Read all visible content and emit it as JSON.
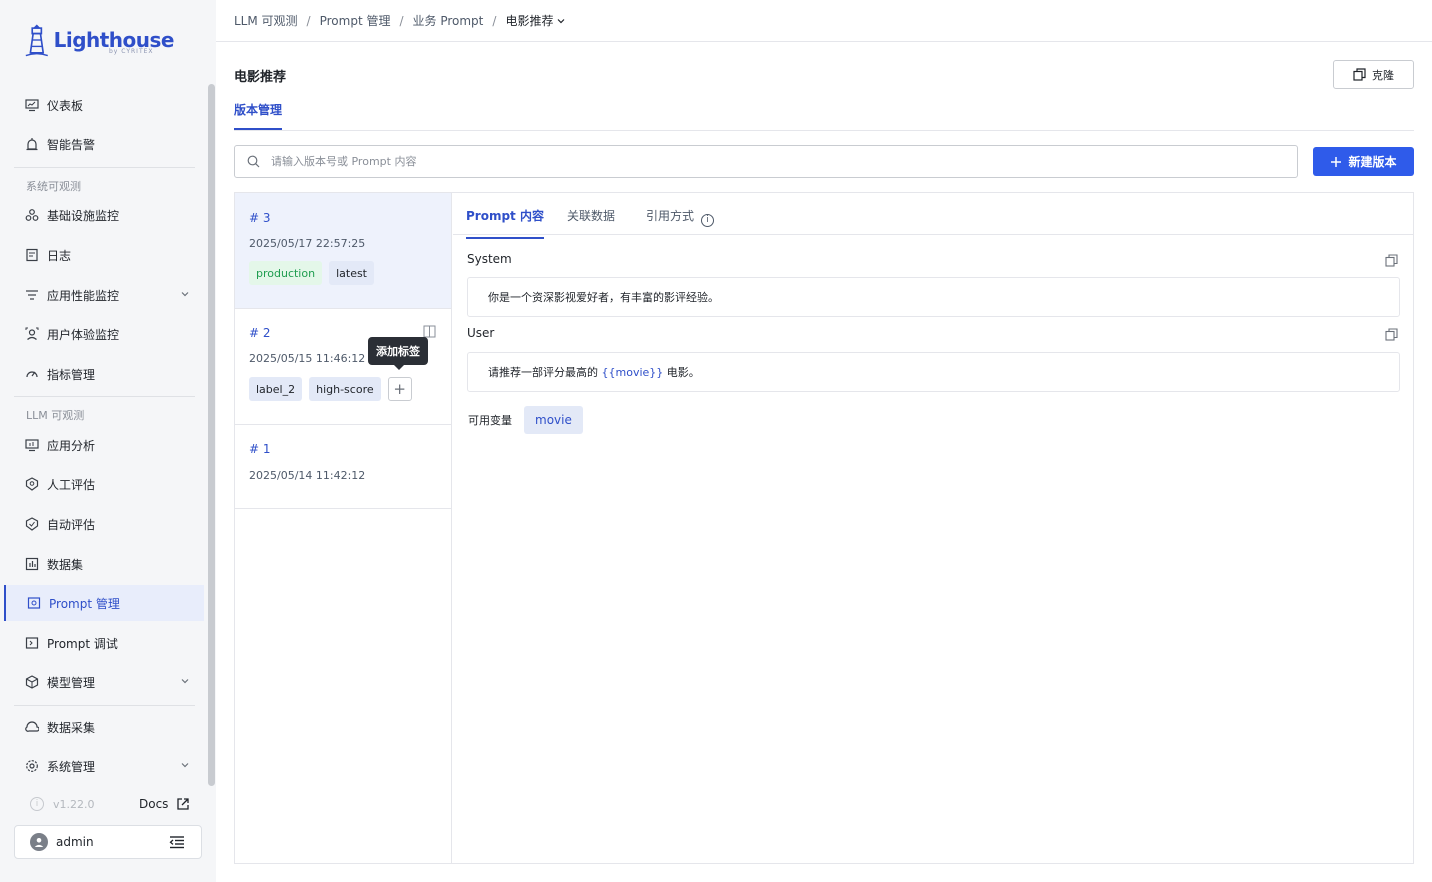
{
  "brand": {
    "name": "Lighthouse",
    "sub": "by CYRITEX"
  },
  "sidebar": {
    "items_top": [
      {
        "label": "仪表板",
        "icon": "monitor-icon"
      },
      {
        "label": "智能告警",
        "icon": "alarm-icon"
      }
    ],
    "group_system": "系统可观测",
    "items_system": [
      {
        "label": "基础设施监控",
        "icon": "infrastructure-icon"
      },
      {
        "label": "日志",
        "icon": "log-icon"
      },
      {
        "label": "应用性能监控",
        "icon": "apm-icon"
      },
      {
        "label": "用户体验监控",
        "icon": "user-experience-icon"
      },
      {
        "label": "指标管理",
        "icon": "metrics-icon"
      }
    ],
    "group_llm": "LLM 可观测",
    "items_llm": [
      {
        "label": "应用分析",
        "icon": "app-analysis-icon"
      },
      {
        "label": "人工评估",
        "icon": "manual-eval-icon"
      },
      {
        "label": "自动评估",
        "icon": "auto-eval-icon"
      },
      {
        "label": "数据集",
        "icon": "dataset-icon"
      },
      {
        "label": "Prompt 管理",
        "icon": "prompt-manage-icon"
      },
      {
        "label": "Prompt 调试",
        "icon": "prompt-debug-icon"
      },
      {
        "label": "模型管理",
        "icon": "model-icon"
      }
    ],
    "items_bottom": [
      {
        "label": "数据采集",
        "icon": "collect-icon"
      },
      {
        "label": "系统管理",
        "icon": "settings-icon"
      }
    ],
    "version": "v1.22.0",
    "docs": "Docs",
    "user": "admin"
  },
  "breadcrumb": [
    "LLM 可观测",
    "Prompt 管理",
    "业务 Prompt",
    "电影推荐"
  ],
  "page": {
    "title": "电影推荐",
    "clone_label": "克隆",
    "tab": "版本管理",
    "search_placeholder": "请输入版本号或 Prompt 内容",
    "new_version_label": "新建版本"
  },
  "versions": [
    {
      "num": "# 3",
      "date": "2025/05/17 22:57:25",
      "tags": [
        "production",
        "latest"
      ]
    },
    {
      "num": "# 2",
      "date": "2025/05/15 11:46:12",
      "tags": [
        "label_2",
        "high-score"
      ]
    },
    {
      "num": "# 1",
      "date": "2025/05/14 11:42:12",
      "tags": []
    }
  ],
  "tooltip": "添加标签",
  "detail": {
    "tabs": [
      "Prompt 内容",
      "关联数据",
      "引用方式"
    ],
    "system_label": "System",
    "system_text": "你是一个资深影视爱好者，有丰富的影评经验。",
    "user_label": "User",
    "user_text_before": "请推荐一部评分最高的 ",
    "user_var": "{{movie}}",
    "user_text_after": " 电影。",
    "vars_label": "可用变量",
    "vars": [
      "movie"
    ]
  },
  "colors": {
    "accent": "#2f4fc9",
    "primary_button": "#2f5bea",
    "green_tag": "#1f9d4f"
  }
}
